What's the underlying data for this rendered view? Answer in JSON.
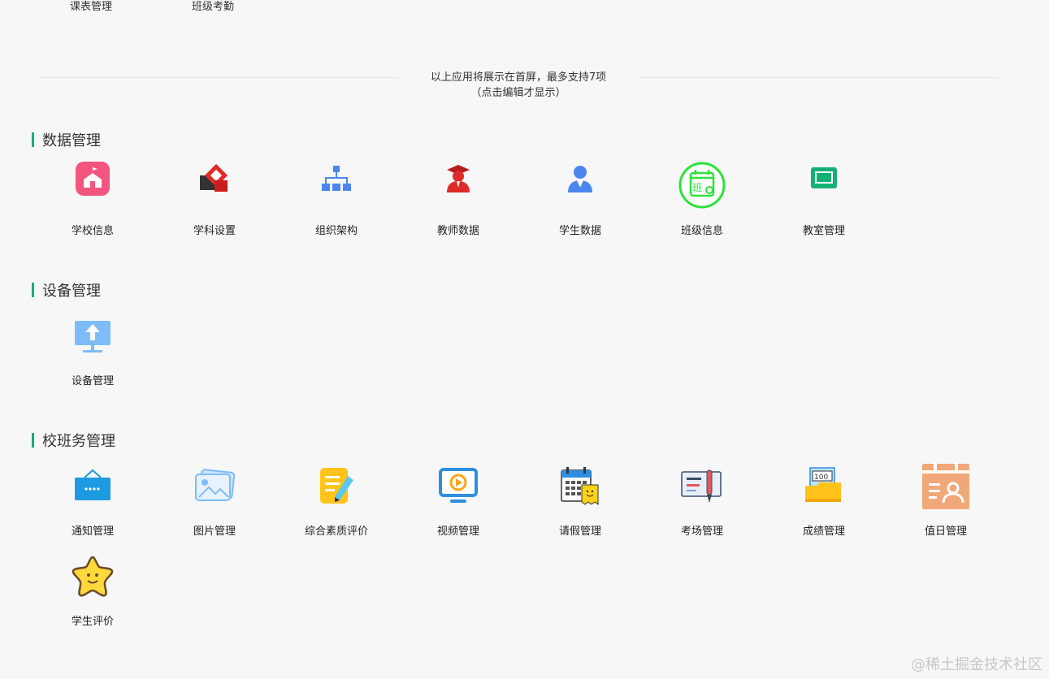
{
  "top_apps": [
    {
      "label": "课表管理"
    },
    {
      "label": "班级考勤"
    }
  ],
  "notice": {
    "line1": "以上应用将展示在首屏，最多支持7项",
    "line2": "（点击编辑才显示）"
  },
  "sections": [
    {
      "title": "数据管理",
      "apps": [
        {
          "label": "学校信息",
          "icon": "school-icon"
        },
        {
          "label": "学科设置",
          "icon": "subject-icon"
        },
        {
          "label": "组织架构",
          "icon": "org-chart-icon"
        },
        {
          "label": "教师数据",
          "icon": "teacher-icon"
        },
        {
          "label": "学生数据",
          "icon": "student-icon"
        },
        {
          "label": "班级信息",
          "icon": "class-badge-icon"
        },
        {
          "label": "教室管理",
          "icon": "classroom-board-icon"
        }
      ]
    },
    {
      "title": "设备管理",
      "apps": [
        {
          "label": "设备管理",
          "icon": "monitor-upload-icon"
        }
      ]
    },
    {
      "title": "校班务管理",
      "apps": [
        {
          "label": "通知管理",
          "icon": "notice-board-icon"
        },
        {
          "label": "图片管理",
          "icon": "picture-icon"
        },
        {
          "label": "综合素质评价",
          "icon": "note-pencil-icon"
        },
        {
          "label": "视频管理",
          "icon": "video-monitor-icon"
        },
        {
          "label": "请假管理",
          "icon": "calendar-leave-icon"
        },
        {
          "label": "考场管理",
          "icon": "exam-card-icon"
        },
        {
          "label": "成绩管理",
          "icon": "score-folder-icon"
        },
        {
          "label": "值日管理",
          "icon": "duty-calendar-icon"
        },
        {
          "label": "学生评价",
          "icon": "star-smile-icon"
        }
      ]
    }
  ],
  "watermark": "@稀土掘金技术社区",
  "colors": {
    "accent": "#15b072",
    "background": "#f7f7f7"
  }
}
